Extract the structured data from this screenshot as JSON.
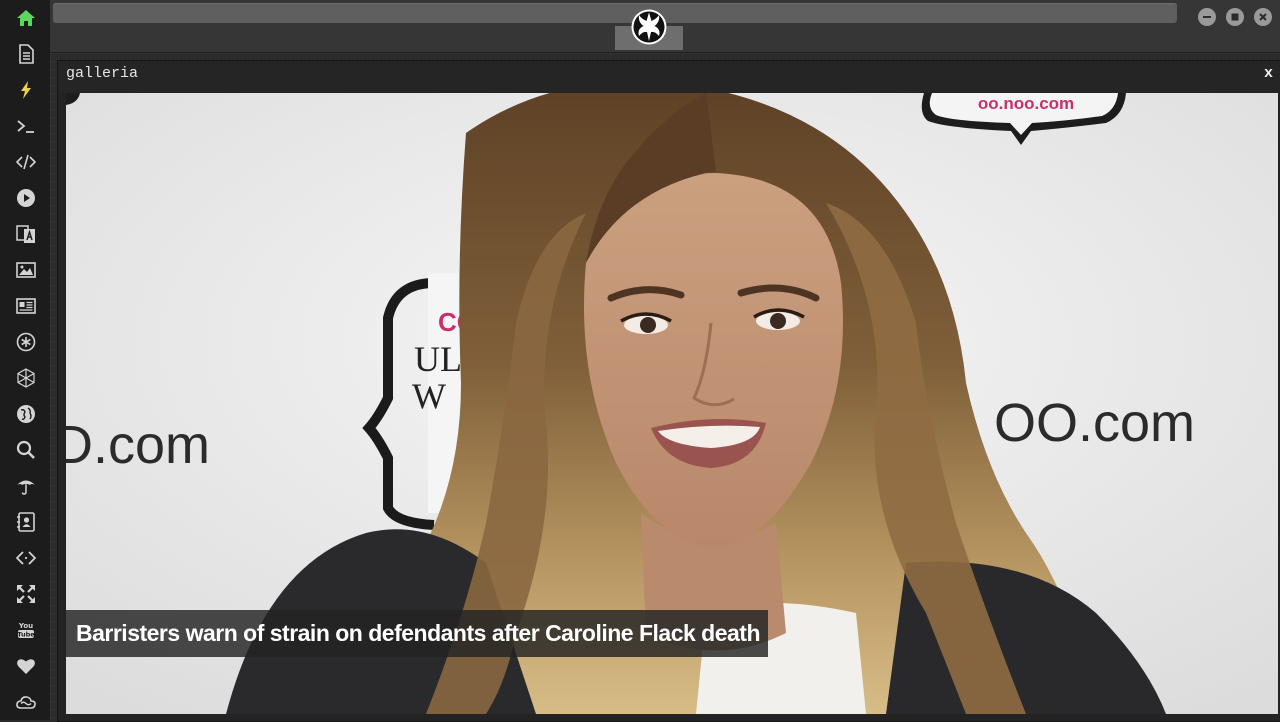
{
  "app": {
    "accent": "#5cd65c",
    "bolt_color": "#e8d24a"
  },
  "sidebar": {
    "items": [
      {
        "name": "home-icon"
      },
      {
        "name": "document-icon"
      },
      {
        "name": "bolt-icon"
      },
      {
        "name": "terminal-icon"
      },
      {
        "name": "code-icon"
      },
      {
        "name": "play-icon"
      },
      {
        "name": "translate-icon"
      },
      {
        "name": "image-icon"
      },
      {
        "name": "newspaper-icon"
      },
      {
        "name": "asterisk-icon"
      },
      {
        "name": "cube-icon"
      },
      {
        "name": "globe-icon"
      },
      {
        "name": "search-icon"
      },
      {
        "name": "umbrella-icon"
      },
      {
        "name": "contact-icon"
      },
      {
        "name": "embed-icon"
      },
      {
        "name": "expand-icon"
      },
      {
        "name": "youtube-icon"
      },
      {
        "name": "heart-icon"
      },
      {
        "name": "cloud-icon"
      }
    ]
  },
  "window_controls": {
    "minimize": "minimize-icon",
    "maximize": "maximize-icon",
    "close": "close-icon"
  },
  "gallery": {
    "title": "galleria",
    "close_label": "x",
    "caption": "Barristers warn of strain on defendants after Caroline Flack death",
    "backdrop_text_left": "D.com",
    "backdrop_text_right": "OO.com"
  }
}
